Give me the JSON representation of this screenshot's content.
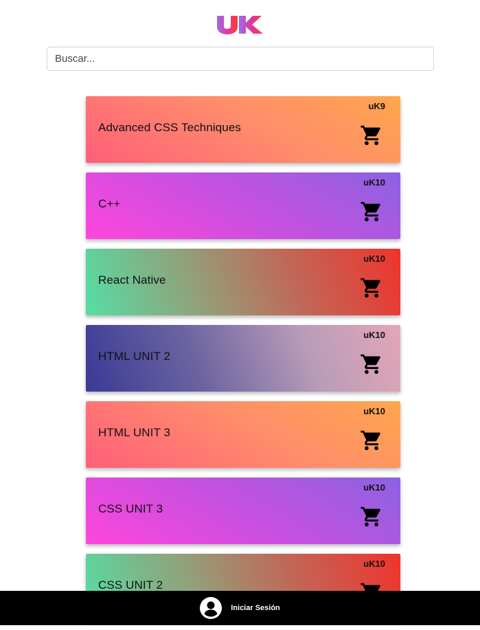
{
  "header": {
    "logo_text": "uK",
    "brand_gradient": [
      "#9b6cf0",
      "#e0379c",
      "#ff3d2e"
    ]
  },
  "search": {
    "placeholder": "Buscar...",
    "value": ""
  },
  "courses": [
    {
      "title": "Advanced CSS Techniques",
      "price": "uK9",
      "theme": "orange",
      "icon": "shopping-cart-icon"
    },
    {
      "title": "C++",
      "price": "uK10",
      "theme": "purple",
      "icon": "shopping-cart-icon"
    },
    {
      "title": "React Native",
      "price": "uK10",
      "theme": "green",
      "icon": "shopping-cart-icon"
    },
    {
      "title": "HTML UNIT 2",
      "price": "uK10",
      "theme": "navy",
      "icon": "shopping-cart-icon"
    },
    {
      "title": "HTML UNIT 3",
      "price": "uK10",
      "theme": "orange",
      "icon": "shopping-cart-icon"
    },
    {
      "title": "CSS UNIT 3",
      "price": "uK10",
      "theme": "purple",
      "icon": "shopping-cart-icon"
    },
    {
      "title": "CSS UNIT 2",
      "price": "uK10",
      "theme": "green",
      "icon": "shopping-cart-icon"
    }
  ],
  "bottom_bar": {
    "login_label": "Iniciar Sesión",
    "icon": "user-account-icon",
    "background": "#000000"
  }
}
